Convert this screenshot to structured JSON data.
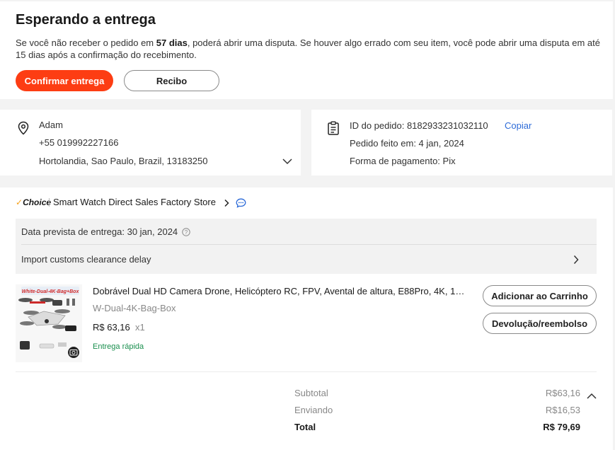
{
  "status": {
    "title": "Esperando a entrega",
    "desc_before": "Se você não receber o pedido em ",
    "desc_days": "57 dias",
    "desc_after": ", poderá abrir uma disputa. Se houver algo errado com seu item, você pode abrir uma disputa em até 15 dias após a confirmação do recebimento.",
    "confirm_label": "Confirmar entrega",
    "receipt_label": "Recibo"
  },
  "address": {
    "name": "Adam",
    "phone": "+55 019992227166",
    "street": "Hortolandia, Sao Paulo, Brazil, 13183250"
  },
  "order": {
    "id_text": "ID do pedido: 8182933231032110",
    "copy_label": "Copiar",
    "date_text": "Pedido feito em: 4 jan, 2024",
    "payment_text": "Forma de pagamento: Pix"
  },
  "store": {
    "badge": "Choice",
    "name": "Smart Watch Direct Sales Factory Store",
    "delivery_date": "Data prevista de entrega: 30 jan, 2024",
    "delay_text": "Import customs clearance delay"
  },
  "product": {
    "image_label": "White-Dual-4K-Bag+Box",
    "title": "Dobrável Dual HD Camera Drone, Helicóptero RC, FPV, Avental de altura, E88Pro, 4K, 10...",
    "variant": "W-Dual-4K-Bag-Box",
    "price": "R$ 63,16",
    "qty": "x1",
    "fast_delivery": "Entrega rápida",
    "add_cart_label": "Adicionar ao Carrinho",
    "refund_label": "Devolução/reembolso"
  },
  "summary": {
    "subtotal_label": "Subtotal",
    "subtotal_value": "R$63,16",
    "shipping_label": "Enviando",
    "shipping_value": "R$16,53",
    "total_label": "Total",
    "total_value": "R$ 79,69"
  },
  "colors": {
    "accent": "#fd3d13",
    "link": "#2d6bd8",
    "green": "#1a8f4e"
  },
  "icons": [
    "pin-icon",
    "receipt-icon",
    "chevron-down-icon",
    "chevron-right-icon",
    "chat-icon",
    "info-icon",
    "chevron-up-icon",
    "camera-icon"
  ]
}
